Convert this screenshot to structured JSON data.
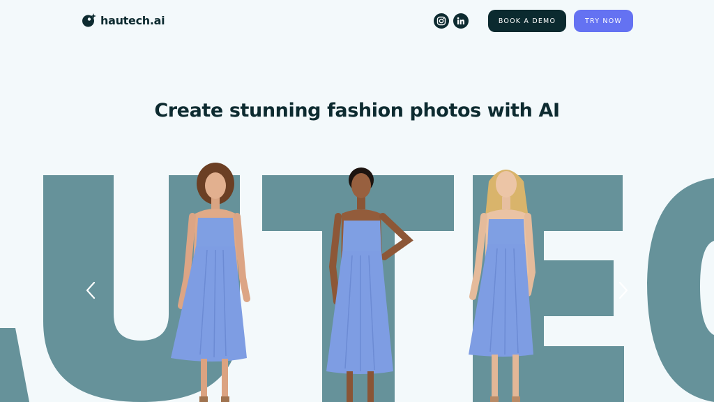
{
  "header": {
    "logo_text": "hautech.ai",
    "social": [
      {
        "name": "instagram",
        "icon": "instagram-icon"
      },
      {
        "name": "linkedin",
        "icon": "linkedin-icon"
      }
    ],
    "book_demo_label": "BOOK A DEMO",
    "try_now_label": "TRY NOW"
  },
  "hero": {
    "headline": "Create stunning fashion photos with AI",
    "background_letters": "AUTEC",
    "carousel": {
      "prev_icon": "chevron-left-icon",
      "next_icon": "chevron-right-icon",
      "models": [
        {
          "icon": "model-photo-curly-brown-hair"
        },
        {
          "icon": "model-photo-braided-dark-hair"
        },
        {
          "icon": "model-photo-long-blonde-hair"
        }
      ]
    }
  },
  "colors": {
    "page_background": "#f3f9fb",
    "text_dark": "#0d2b30",
    "backdrop_letters": "#66929a",
    "book_demo_bg": "#0b2a2f",
    "try_now_bg": "#6472f2",
    "dress_blue": "#7e9de3"
  }
}
